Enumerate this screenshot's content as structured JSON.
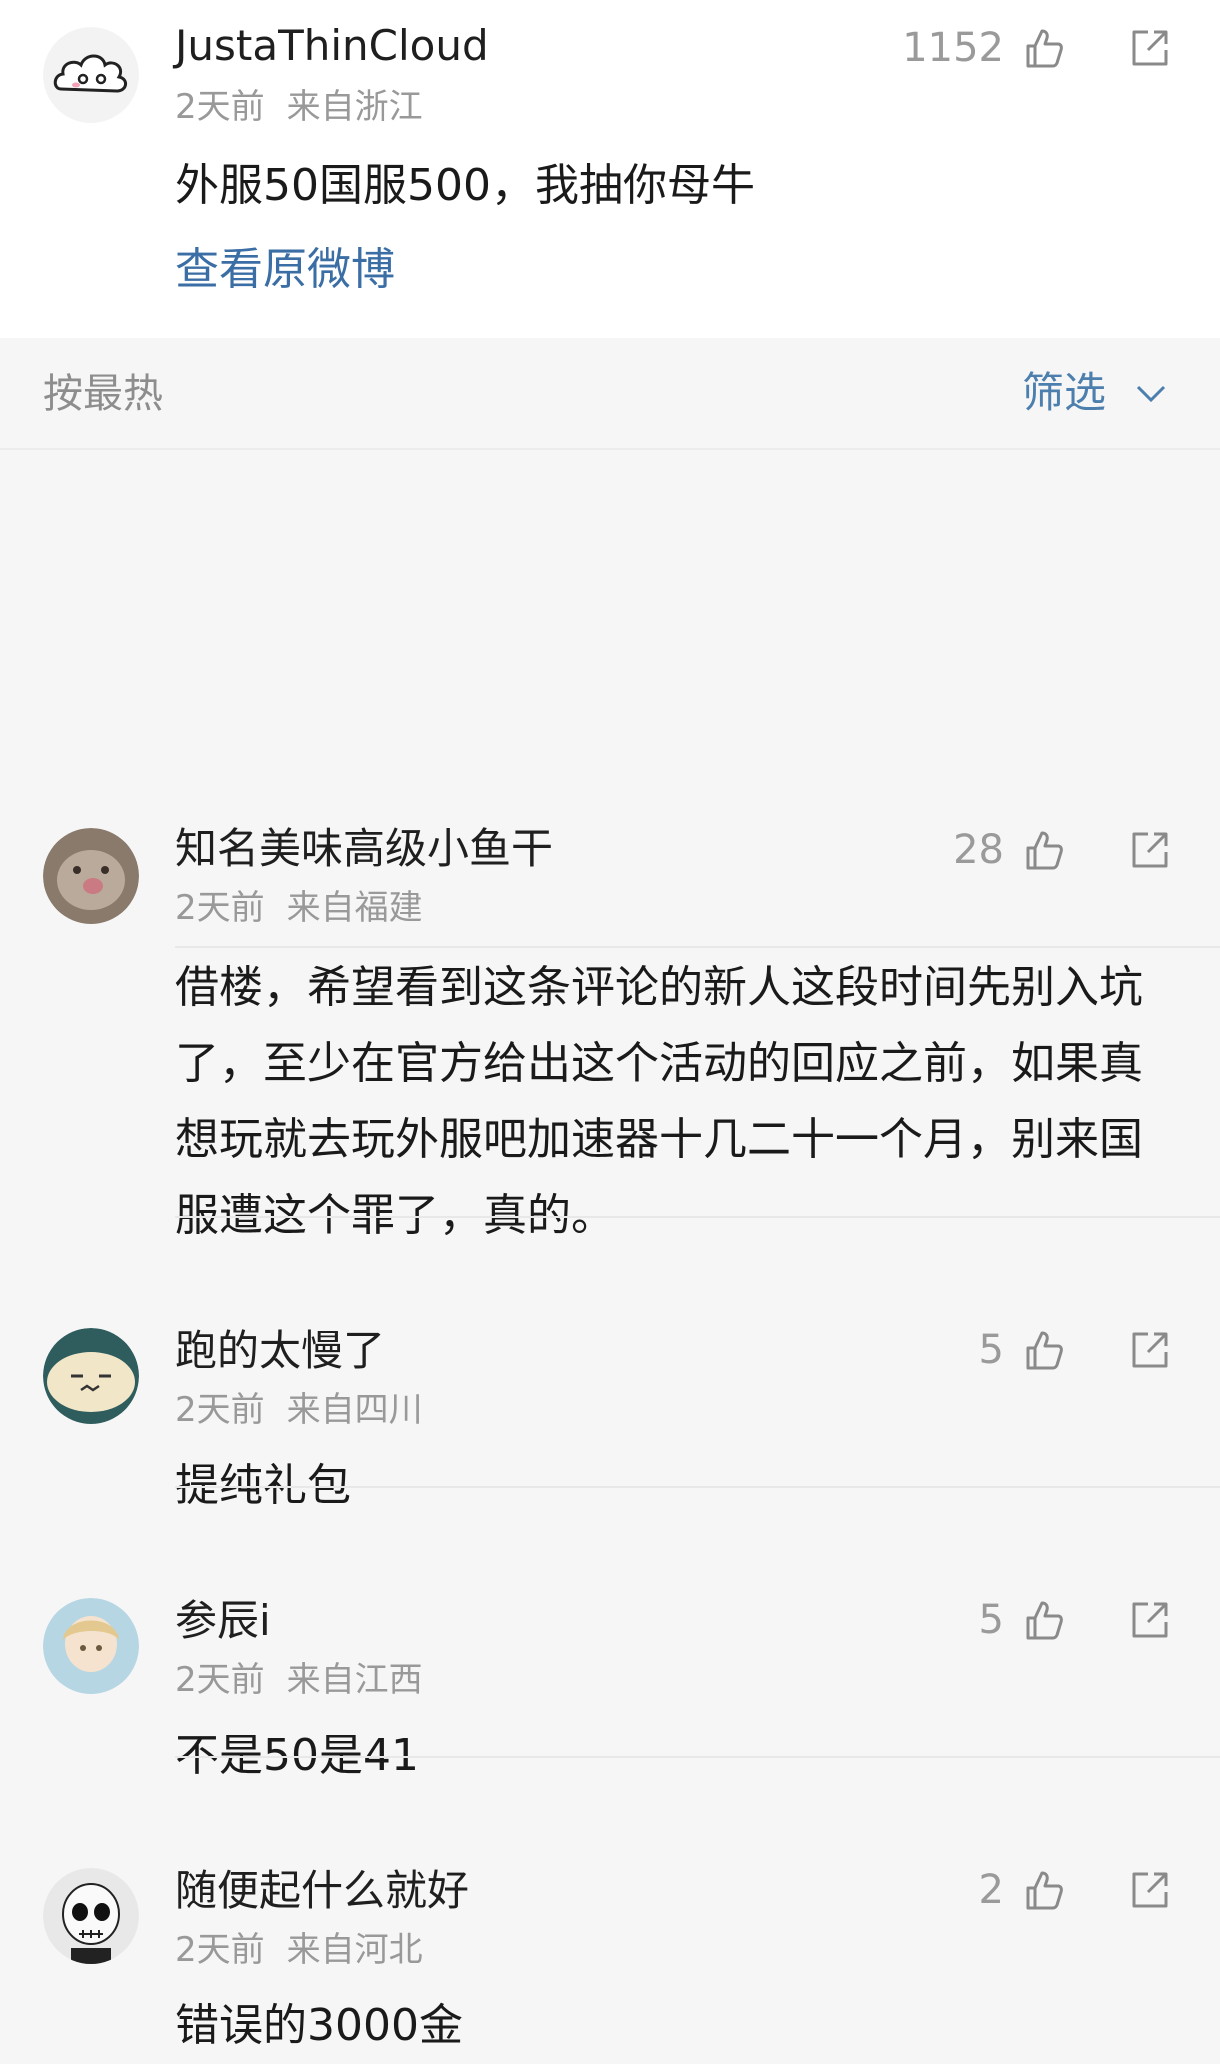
{
  "post": {
    "author": "JustaThinCloud",
    "time": "2天前",
    "location": "来自浙江",
    "likes": "1152",
    "text": "外服50国服500，我抽你母牛",
    "view_original": "查看原微博"
  },
  "sort": {
    "label": "按最热",
    "filter_label": "筛选"
  },
  "comments": [
    {
      "author": "知名美味高级小鱼干",
      "time": "2天前",
      "location": "来自福建",
      "likes": "28",
      "text": "借楼，希望看到这条评论的新人这段时间先别入坑了，至少在官方给出这个活动的回应之前，如果真想玩就去玩外服吧加速器十几二十一个月，别来国服遭这个罪了，真的。"
    },
    {
      "author": "跑的太慢了",
      "time": "2天前",
      "location": "来自四川",
      "likes": "5",
      "text": "提纯礼包"
    },
    {
      "author": "参辰i",
      "time": "2天前",
      "location": "来自江西",
      "likes": "5",
      "text": "不是50是41"
    },
    {
      "author": "随便起什么就好",
      "time": "2天前",
      "location": "来自河北",
      "likes": "2",
      "text": "错误的3000金"
    }
  ]
}
